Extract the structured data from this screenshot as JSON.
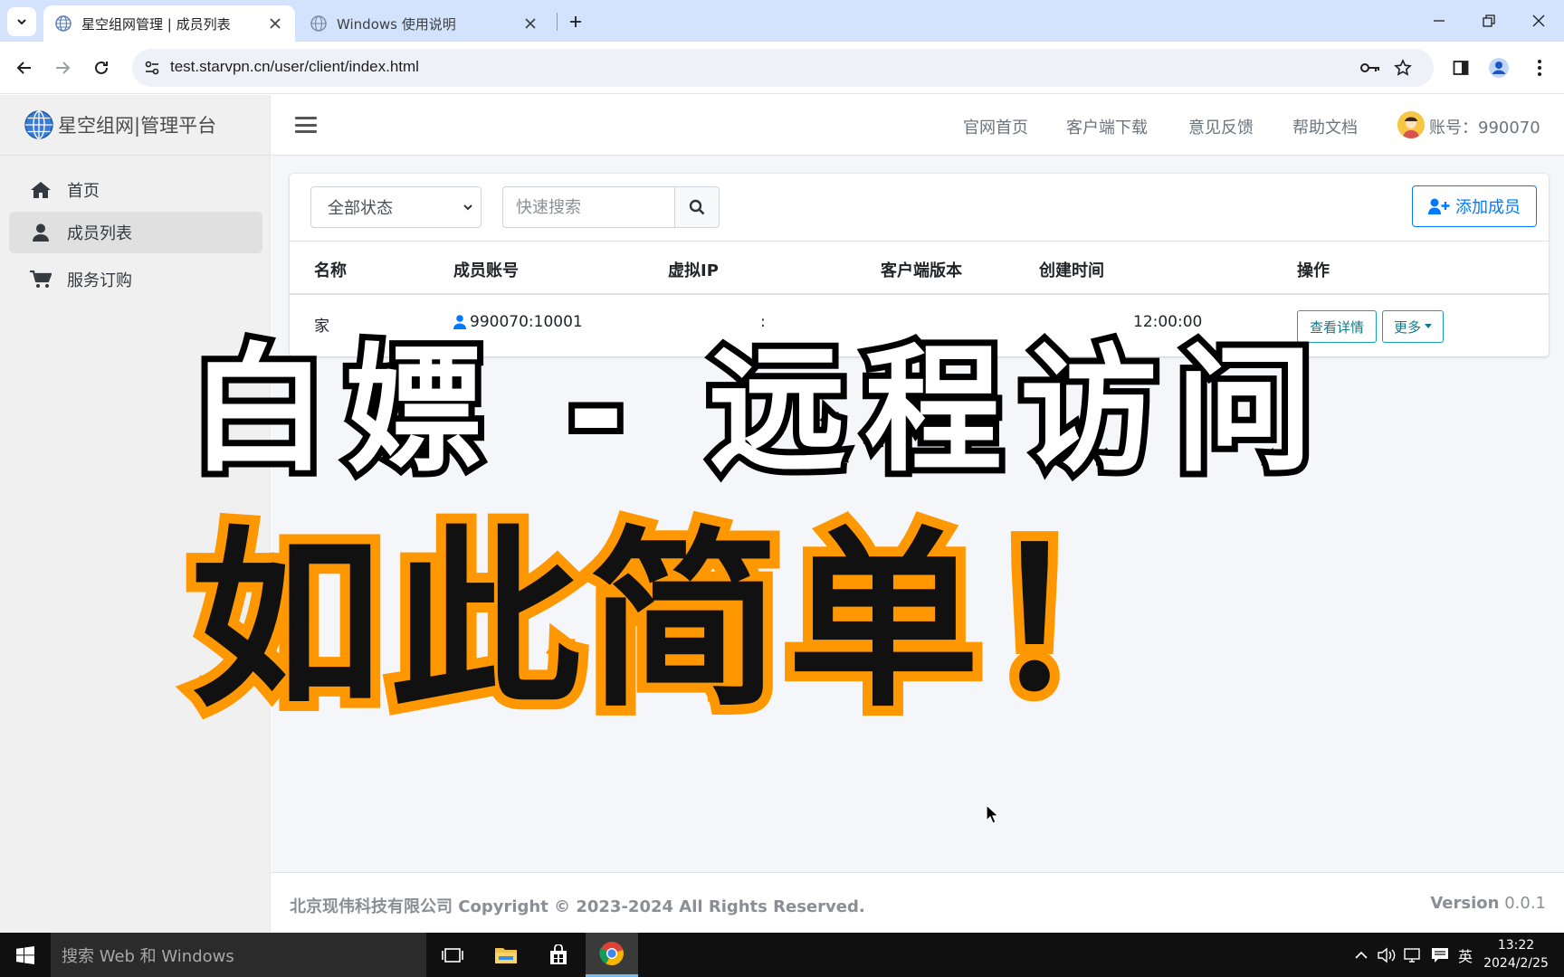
{
  "browser": {
    "tabs": [
      {
        "title": "星空组网管理 | 成员列表",
        "active": true
      },
      {
        "title": "Windows 使用说明",
        "active": false
      }
    ],
    "url": "test.starvpn.cn/user/client/index.html"
  },
  "sidebar": {
    "brand": "星空组网|管理平台",
    "items": [
      {
        "label": "首页",
        "icon": "home-icon"
      },
      {
        "label": "成员列表",
        "icon": "user-icon",
        "active": true
      },
      {
        "label": "服务订购",
        "icon": "cart-icon"
      }
    ]
  },
  "header": {
    "links": [
      "官网首页",
      "客户端下载",
      "意见反馈",
      "帮助文档"
    ],
    "account": "账号：990070"
  },
  "toolbar": {
    "status_select": "全部状态",
    "search_placeholder": "快速搜索",
    "add_member_label": "添加成员"
  },
  "table": {
    "columns": [
      "名称",
      "成员账号",
      "虚拟IP",
      "客户端版本",
      "创建时间",
      "操作"
    ],
    "rows": [
      {
        "name": "家",
        "account": "990070:10001",
        "ip": ":",
        "version": "",
        "created": "12:00:00",
        "view_label": "查看详情",
        "more_label": "更多"
      }
    ]
  },
  "footer": {
    "company": "北京现伟科技有限公司",
    "copyright": "Copyright © 2023-2024 All Rights Reserved.",
    "version_label": "Version",
    "version": "0.0.1"
  },
  "overlay": {
    "line1": "白嫖 - 远程访问",
    "line2": "如此简单！"
  },
  "taskbar": {
    "search_placeholder": "搜索 Web 和 Windows",
    "ime": "英",
    "time": "13:22",
    "date": "2024/2/25"
  },
  "colors": {
    "accent": "#007bff",
    "info": "#17a2b8",
    "caption_outline": "#ff9800",
    "tabstrip": "#d3e3fd"
  }
}
